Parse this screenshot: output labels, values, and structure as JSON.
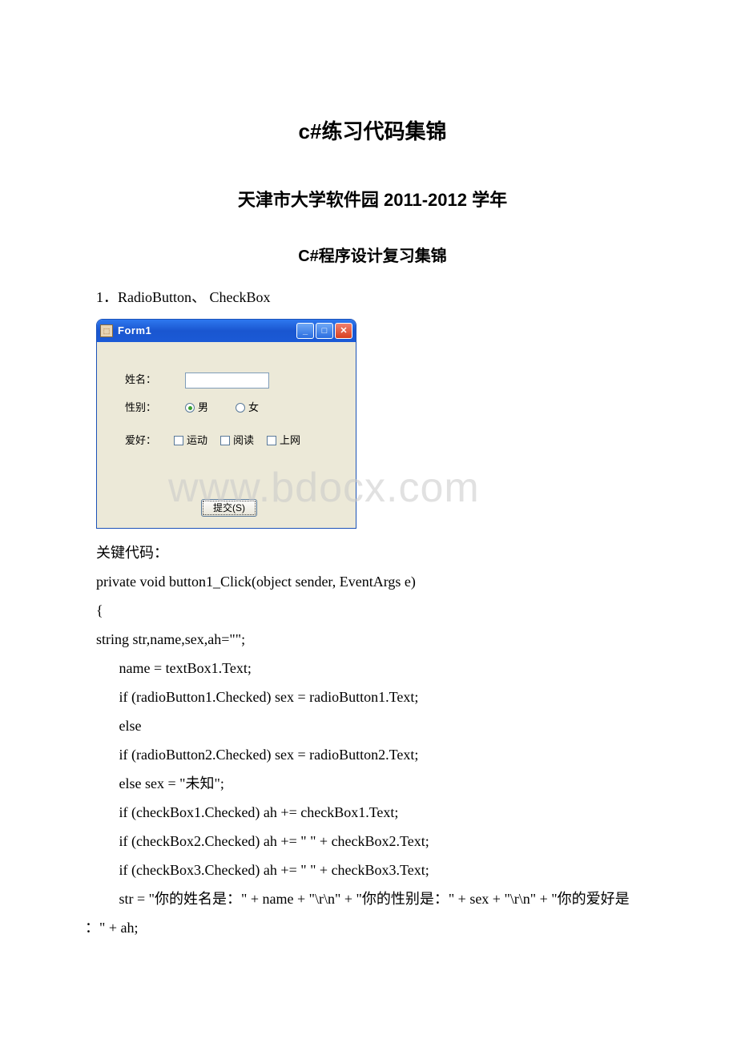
{
  "title_main": "c#练习代码集锦",
  "title_sub1": "天津市大学软件园 2011-2012 学年",
  "title_sub2": "C#程序设计复习集锦",
  "section_label": "1．RadioButton、 CheckBox",
  "watermark": "www.bdocx.com",
  "winform": {
    "title": "Form1",
    "labels": {
      "name": "姓名：",
      "sex": "性别：",
      "hobby": "爱好："
    },
    "radios": {
      "male": "男",
      "female": "女"
    },
    "checks": {
      "sport": "运动",
      "read": "阅读",
      "net": "上网"
    },
    "submit": "提交(S)"
  },
  "code": {
    "l1": "关键代码：",
    "l2": "private void button1_Click(object sender, EventArgs e)",
    "l3": "{",
    "l4": "string str,name,sex,ah=\"\";",
    "l5": "",
    "l6": " name = textBox1.Text;",
    "l7": " if (radioButton1.Checked) sex = radioButton1.Text;",
    "l8": " else",
    "l9": " if (radioButton2.Checked) sex = radioButton2.Text;",
    "l10": " else sex = \"未知\";",
    "l11": " if (checkBox1.Checked) ah += checkBox1.Text;",
    "l12": " if (checkBox2.Checked) ah += \" \" + checkBox2.Text;",
    "l13": " if (checkBox3.Checked) ah += \" \" + checkBox3.Text;",
    "l14a": " str = \"你的姓名是：\" + name + \"\\r\\n\" + \"你的性别是：\" + sex + \"\\r\\n\" + \"你的爱好是",
    "l14b": "：\" + ah;"
  }
}
